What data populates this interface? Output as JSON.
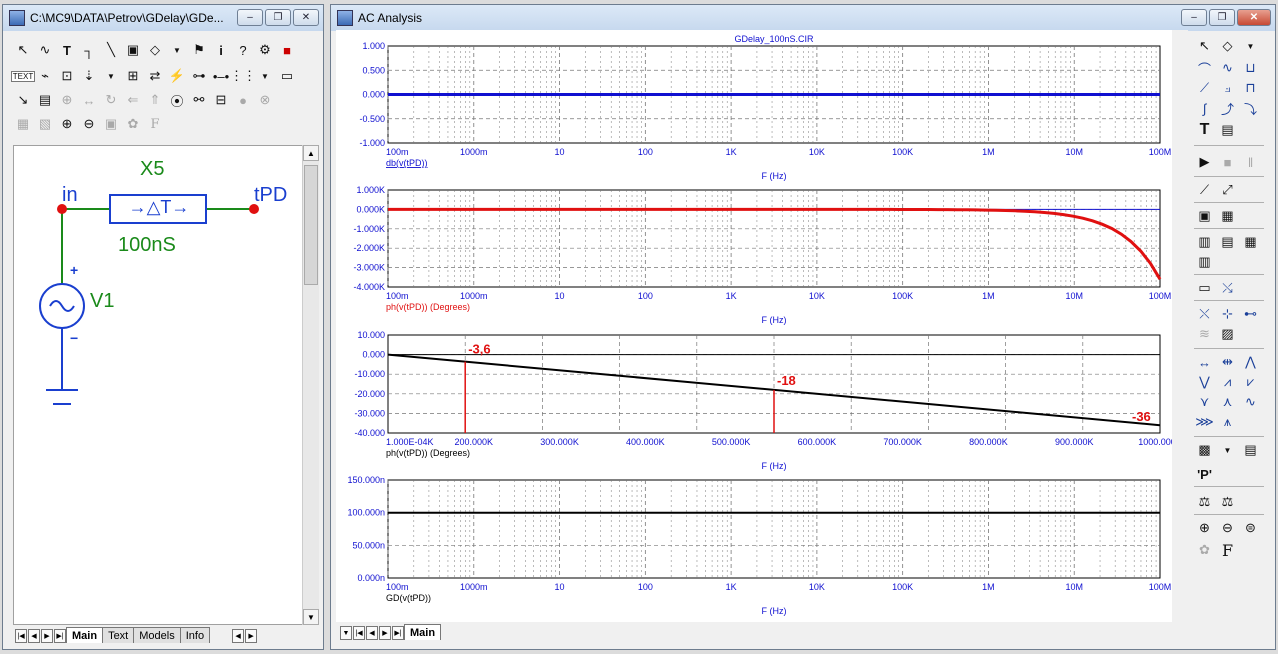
{
  "schematic_window": {
    "title": "C:\\MC9\\DATA\\Petrov\\GDelay\\GDe...",
    "tabs": [
      "Main",
      "Text",
      "Models",
      "Info"
    ],
    "active_tab": "Main",
    "components": {
      "delay_name": "X5",
      "delay_symbol": "→△T→",
      "delay_value": "100nS",
      "source_name": "V1",
      "node_in": "in",
      "node_out": "tPD",
      "plus": "+",
      "minus": "−"
    }
  },
  "analysis_window": {
    "title": "AC Analysis",
    "tabs": [
      "Main"
    ],
    "active_tab": "Main"
  },
  "icons": {
    "close": "✕",
    "minimize": "‒",
    "restore": "❐",
    "pointer": "↖",
    "wire": "∿",
    "text": "T",
    "find": "⦿",
    "zoom_in": "⊕",
    "zoom_out": "⊖",
    "font": "F",
    "play": "▶",
    "stop": "■",
    "pause": "‖"
  },
  "colors": {
    "db_trace": "#1010d0",
    "phase_trace": "#e01010",
    "linear_phase_trace": "#000000",
    "gd_trace": "#000000",
    "marker": "#e01010",
    "axis_text": "#1010d0"
  },
  "chart_data": [
    {
      "type": "line",
      "title": "GDelay_100nS.CIR",
      "xlabel": "F (Hz)",
      "ylabel": "db(v(tPD))",
      "x_scale": "log",
      "xlim": [
        0.1,
        100000000
      ],
      "ylim": [
        -1.0,
        1.0
      ],
      "x_ticks": [
        "100m",
        "1000m",
        "10",
        "100",
        "1K",
        "10K",
        "100K",
        "1M",
        "10M",
        "100M"
      ],
      "y_ticks": [
        "1.000",
        "0.500",
        "0.000",
        "-0.500",
        "-1.000"
      ],
      "series": [
        {
          "name": "db(v(tPD))",
          "x": [
            0.1,
            100000000
          ],
          "y": [
            0,
            0
          ]
        }
      ]
    },
    {
      "type": "line",
      "xlabel": "F (Hz)",
      "ylabel": "ph(v(tPD)) (Degrees)",
      "x_scale": "log",
      "xlim": [
        0.1,
        100000000
      ],
      "ylim": [
        -4000,
        1000
      ],
      "x_ticks": [
        "100m",
        "1000m",
        "10",
        "100",
        "1K",
        "10K",
        "100K",
        "1M",
        "10M",
        "100M"
      ],
      "y_ticks": [
        "1.000K",
        "0.000K",
        "-1.000K",
        "-2.000K",
        "-3.000K",
        "-4.000K"
      ],
      "series": [
        {
          "name": "ph(v(tPD)) (Degrees)",
          "x": [
            0.1,
            1000000,
            3000000,
            10000000,
            20000000,
            40000000,
            60000000,
            80000000,
            100000000
          ],
          "y": [
            0,
            -36,
            -108,
            -360,
            -720,
            -1440,
            -2160,
            -2880,
            -3600
          ]
        }
      ]
    },
    {
      "type": "line",
      "xlabel": "F (Hz)",
      "ylabel": "ph(v(tPD)) (Degrees)",
      "x_scale": "linear",
      "xlim": [
        0,
        1000000
      ],
      "ylim": [
        -40,
        10
      ],
      "x_ticks": [
        "1.000E-04K",
        "200.000K",
        "300.000K",
        "400.000K",
        "500.000K",
        "600.000K",
        "700.000K",
        "800.000K",
        "900.000K",
        "1000.000K"
      ],
      "y_ticks": [
        "10.000",
        "0.000",
        "-10.000",
        "-20.000",
        "-30.000",
        "-40.000"
      ],
      "series": [
        {
          "name": "ph(v(tPD)) (Degrees)",
          "x": [
            0,
            1000000
          ],
          "y": [
            0,
            -36
          ]
        }
      ],
      "annotations": [
        {
          "text": "-3,6",
          "x": 100000,
          "y": -3.6
        },
        {
          "text": "-18",
          "x": 500000,
          "y": -18
        },
        {
          "text": "-36",
          "x": 1000000,
          "y": -36
        }
      ]
    },
    {
      "type": "line",
      "xlabel": "F (Hz)",
      "ylabel": "GD(v(tPD))",
      "x_scale": "log",
      "xlim": [
        0.1,
        100000000
      ],
      "ylim": [
        0,
        1.5e-07
      ],
      "x_ticks": [
        "100m",
        "1000m",
        "10",
        "100",
        "1K",
        "10K",
        "100K",
        "1M",
        "10M",
        "100M"
      ],
      "y_ticks": [
        "150.000n",
        "100.000n",
        "50.000n",
        "0.000n"
      ],
      "series": [
        {
          "name": "GD(v(tPD))",
          "x": [
            0.1,
            100000000
          ],
          "y": [
            1e-07,
            1e-07
          ]
        }
      ]
    }
  ]
}
